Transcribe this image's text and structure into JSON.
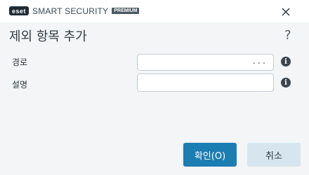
{
  "brand": {
    "badge": "eset",
    "name": "SMART SECURITY",
    "edition": "PREMIUM"
  },
  "dialog": {
    "title": "제외 항목 추가",
    "help_symbol": "?"
  },
  "fields": {
    "path": {
      "label": "경로",
      "value": "",
      "browse": "..."
    },
    "description": {
      "label": "설명",
      "value": ""
    }
  },
  "buttons": {
    "ok": "확인(O)",
    "cancel": "취소"
  },
  "colors": {
    "primary": "#1c7db3",
    "secondary": "#d7e6ee",
    "panel": "#f3f5f6"
  }
}
